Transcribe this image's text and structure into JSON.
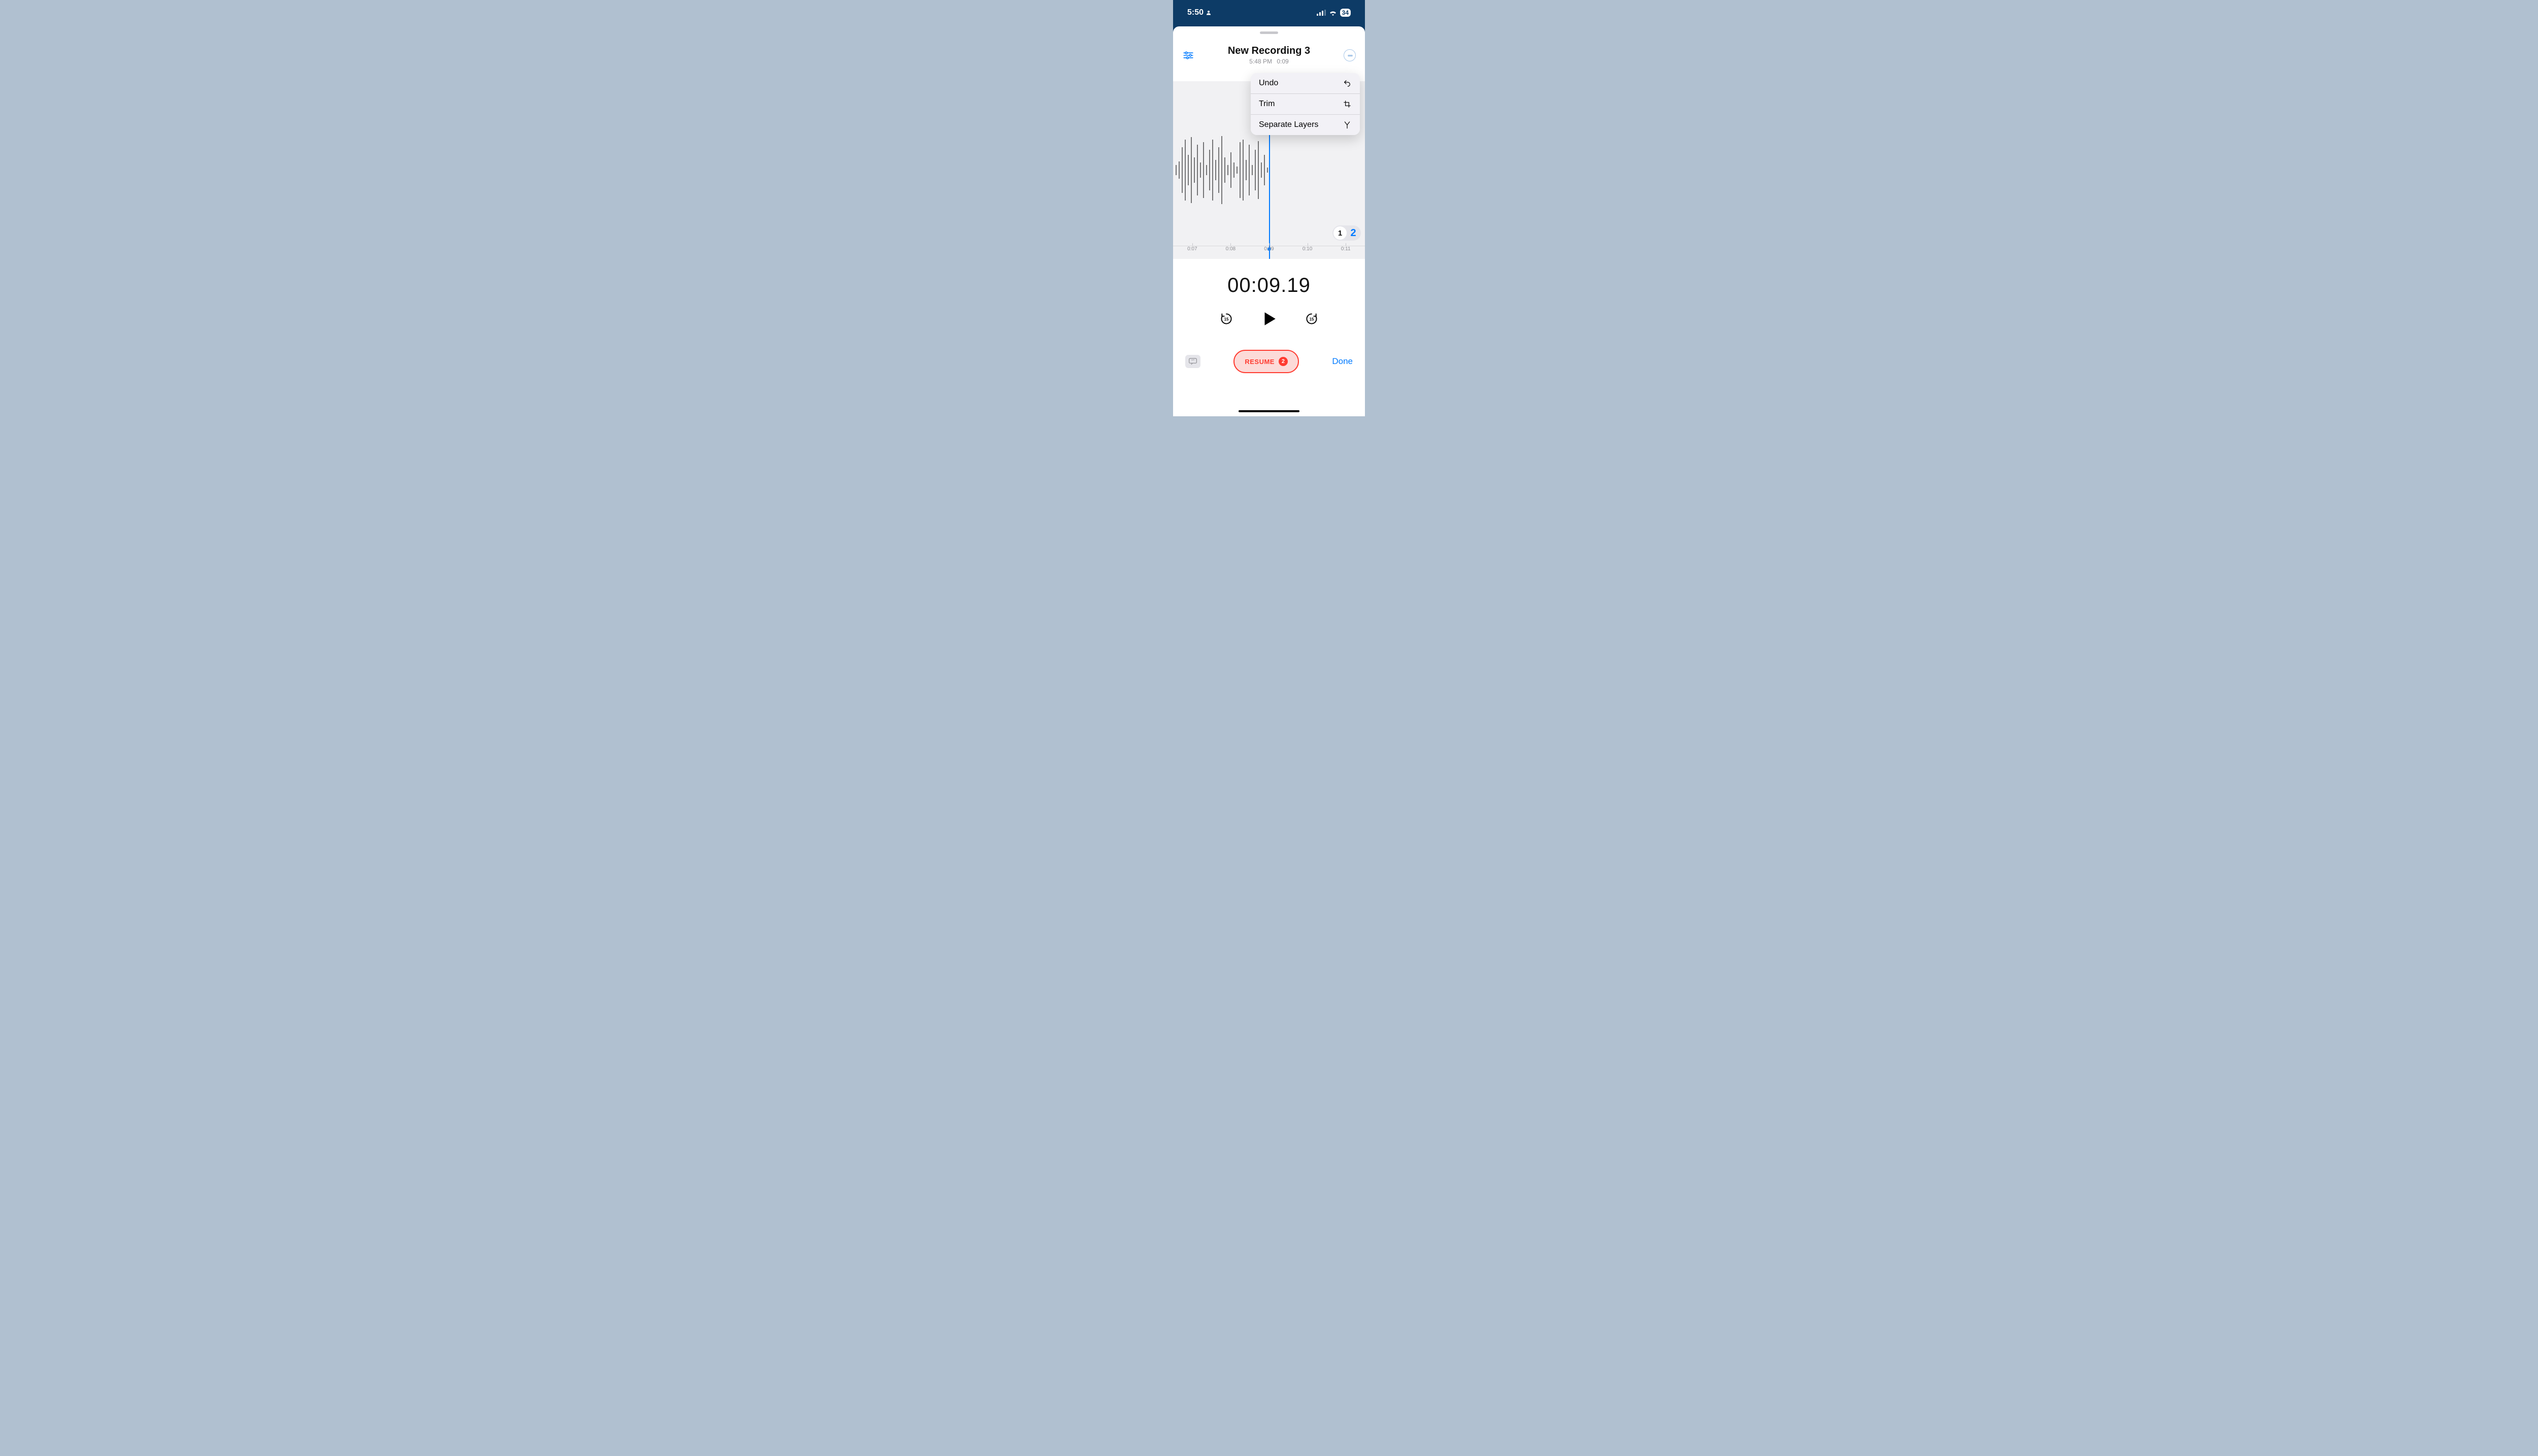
{
  "status": {
    "time": "5:50",
    "battery": "34"
  },
  "header": {
    "title": "New Recording 3",
    "timestamp": "5:48 PM",
    "duration": "0:09"
  },
  "popover": {
    "items": [
      {
        "label": "Undo"
      },
      {
        "label": "Trim"
      },
      {
        "label": "Separate Layers"
      }
    ]
  },
  "timeline": {
    "ticks": [
      "0:07",
      "0:08",
      "0:09",
      "0:10",
      "0:11"
    ]
  },
  "layers": {
    "one": "1",
    "two": "2"
  },
  "bigTime": "00:09.19",
  "skipSeconds": "15",
  "resume": {
    "label": "RESUME",
    "badge": "2"
  },
  "done": "Done"
}
